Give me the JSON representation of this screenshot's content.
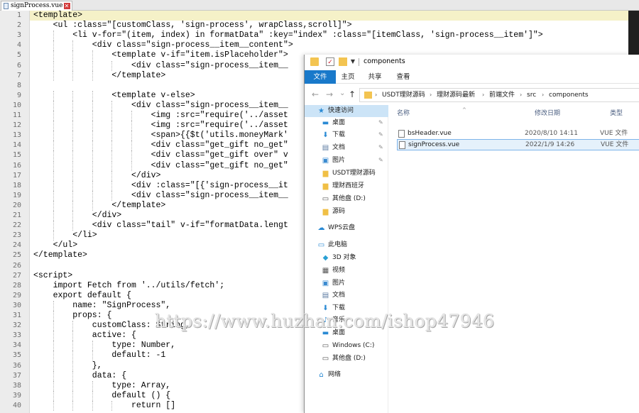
{
  "editor": {
    "tab": {
      "filename": "signProcess.vue",
      "close_icon": "close-icon"
    },
    "current_line": 1,
    "lines": [
      {
        "n": "1",
        "indent": 0,
        "text": "<template>"
      },
      {
        "n": "2",
        "indent": 4,
        "text": "<ul :class=\"[customClass, 'sign-process', wrapClass,scroll]\">"
      },
      {
        "n": "3",
        "indent": 8,
        "text": "<li v-for=\"(item, index) in formatData\" :key=\"index\" :class=\"[itemClass, 'sign-process__item']\">"
      },
      {
        "n": "4",
        "indent": 12,
        "text": "<div class=\"sign-process__item__content\">"
      },
      {
        "n": "5",
        "indent": 16,
        "text": "<template v-if=\"item.isPlaceholder\">"
      },
      {
        "n": "6",
        "indent": 20,
        "text": "<div class=\"sign-process__item__"
      },
      {
        "n": "7",
        "indent": 16,
        "text": "</template>"
      },
      {
        "n": "8",
        "indent": 0,
        "text": ""
      },
      {
        "n": "9",
        "indent": 16,
        "text": "<template v-else>"
      },
      {
        "n": "10",
        "indent": 20,
        "text": "<div class=\"sign-process__item__"
      },
      {
        "n": "11",
        "indent": 24,
        "text": "<img :src=\"require('../asset"
      },
      {
        "n": "12",
        "indent": 24,
        "text": "<img :src=\"require('../asset"
      },
      {
        "n": "13",
        "indent": 24,
        "text": "<span>{{$t('utils.moneyMark'"
      },
      {
        "n": "14",
        "indent": 24,
        "text": "<div class=\"get_gift no_get\""
      },
      {
        "n": "15",
        "indent": 24,
        "text": "<div class=\"get_gift over\" v"
      },
      {
        "n": "16",
        "indent": 24,
        "text": "<div class=\"get_gift no_get\""
      },
      {
        "n": "17",
        "indent": 20,
        "text": "</div>"
      },
      {
        "n": "18",
        "indent": 20,
        "text": "<div :class=\"[{'sign-process__it"
      },
      {
        "n": "19",
        "indent": 20,
        "text": "<div class=\"sign-process__item__"
      },
      {
        "n": "20",
        "indent": 16,
        "text": "</template>"
      },
      {
        "n": "21",
        "indent": 12,
        "text": "</div>"
      },
      {
        "n": "22",
        "indent": 12,
        "text": "<div class=\"tail\" v-if=\"formatData.lengt"
      },
      {
        "n": "23",
        "indent": 8,
        "text": "</li>"
      },
      {
        "n": "24",
        "indent": 4,
        "text": "</ul>"
      },
      {
        "n": "25",
        "indent": 0,
        "text": "</template>"
      },
      {
        "n": "26",
        "indent": 0,
        "text": ""
      },
      {
        "n": "27",
        "indent": 0,
        "text": "<script>"
      },
      {
        "n": "28",
        "indent": 4,
        "text": "import Fetch from '../utils/fetch';"
      },
      {
        "n": "29",
        "indent": 4,
        "text": "export default {"
      },
      {
        "n": "30",
        "indent": 8,
        "text": "name: \"SignProcess\","
      },
      {
        "n": "31",
        "indent": 8,
        "text": "props: {"
      },
      {
        "n": "32",
        "indent": 12,
        "text": "customClass: String,"
      },
      {
        "n": "33",
        "indent": 12,
        "text": "active: {"
      },
      {
        "n": "34",
        "indent": 16,
        "text": "type: Number,"
      },
      {
        "n": "35",
        "indent": 16,
        "text": "default: -1"
      },
      {
        "n": "36",
        "indent": 12,
        "text": "},"
      },
      {
        "n": "37",
        "indent": 12,
        "text": "data: {"
      },
      {
        "n": "38",
        "indent": 16,
        "text": "type: Array,"
      },
      {
        "n": "39",
        "indent": 16,
        "text": "default () {"
      },
      {
        "n": "40",
        "indent": 20,
        "text": "return []"
      }
    ]
  },
  "explorer": {
    "title": "components",
    "ribbon_tabs": [
      "文件",
      "主页",
      "共享",
      "查看"
    ],
    "nav_buttons": {
      "back": "←",
      "forward": "→",
      "recent": "⌄",
      "up": "↑"
    },
    "breadcrumbs": [
      "USDT理财源码",
      "理财源码最新",
      "前端文件",
      "src",
      "components"
    ],
    "sidebar": [
      {
        "label": "快速访问",
        "icon": "star-icon",
        "pinned": false,
        "selected": true,
        "group": true
      },
      {
        "label": "桌面",
        "icon": "desktop-icon",
        "pinned": true
      },
      {
        "label": "下载",
        "icon": "download-icon",
        "pinned": true
      },
      {
        "label": "文档",
        "icon": "document-icon",
        "pinned": true
      },
      {
        "label": "图片",
        "icon": "picture-icon",
        "pinned": true
      },
      {
        "label": "USDT理财源码",
        "icon": "folder-icon",
        "pinned": false
      },
      {
        "label": "理财西班牙",
        "icon": "folder-icon",
        "pinned": false
      },
      {
        "label": "其他盘 (D:)",
        "icon": "drive-icon",
        "pinned": false
      },
      {
        "label": "源码",
        "icon": "folder-icon",
        "pinned": false
      },
      {
        "label": "WPS云盘",
        "icon": "cloud-icon",
        "pinned": false,
        "group": true
      },
      {
        "label": "此电脑",
        "icon": "computer-icon",
        "pinned": false,
        "group": true
      },
      {
        "label": "3D 对象",
        "icon": "3d-objects-icon",
        "pinned": false
      },
      {
        "label": "视频",
        "icon": "video-icon",
        "pinned": false
      },
      {
        "label": "图片",
        "icon": "picture-icon",
        "pinned": false
      },
      {
        "label": "文档",
        "icon": "document-icon",
        "pinned": false
      },
      {
        "label": "下载",
        "icon": "download-icon",
        "pinned": false
      },
      {
        "label": "音乐",
        "icon": "music-icon",
        "pinned": false
      },
      {
        "label": "桌面",
        "icon": "desktop-icon",
        "pinned": false
      },
      {
        "label": "Windows (C:)",
        "icon": "drive-icon",
        "pinned": false
      },
      {
        "label": "其他盘 (D:)",
        "icon": "drive-icon",
        "pinned": false
      },
      {
        "label": "网络",
        "icon": "network-icon",
        "pinned": false,
        "group": true
      }
    ],
    "columns": {
      "name": "名称",
      "date": "修改日期",
      "type": "类型"
    },
    "files": [
      {
        "name": "bsHeader.vue",
        "date": "2020/8/10 14:11",
        "type": "VUE 文件",
        "selected": false
      },
      {
        "name": "signProcess.vue",
        "date": "2022/1/9 14:26",
        "type": "VUE 文件",
        "selected": true
      }
    ]
  },
  "watermark": "https://www.huzhan.com/ishop47946",
  "colors": {
    "accent": "#1979ca",
    "selection": "#cce4f7",
    "current_line": "#f5f1c8",
    "close_red": "#d23b3b"
  }
}
